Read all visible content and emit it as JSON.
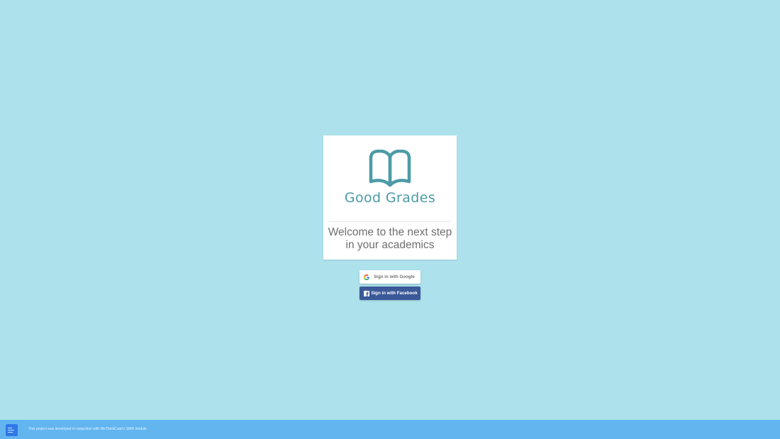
{
  "brand": {
    "name": "Good Grades",
    "logo_icon": "open-book-icon",
    "color": "#4c9ba6"
  },
  "card": {
    "welcome_line1": "Welcome to the next step",
    "welcome_line2": "in your academics"
  },
  "auth": {
    "google": {
      "label": "Sign in with Google",
      "icon": "google-icon"
    },
    "facebook": {
      "label": "Sign in with Facebook",
      "icon": "facebook-icon",
      "color": "#3b5998"
    }
  },
  "footer": {
    "text": "This project was developed in conjuction with WeThinkCode's SMR module.",
    "logo_icon": "wethinkcode-logo-icon",
    "color": "#62b5ef"
  },
  "colors": {
    "background": "#ade2ec",
    "card": "#ffffff"
  }
}
